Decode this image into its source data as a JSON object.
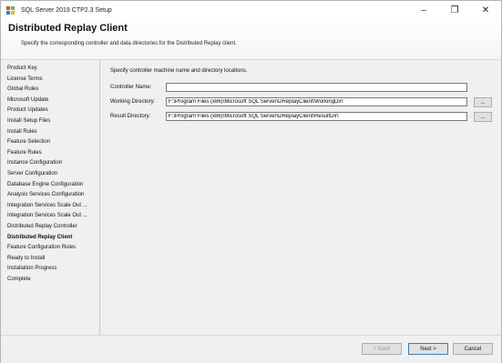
{
  "window": {
    "title": "SQL Server 2019 CTP2.3 Setup",
    "controls": {
      "minimize": "–",
      "maximize": "❐",
      "close": "✕"
    }
  },
  "header": {
    "title": "Distributed Replay Client",
    "subtitle": "Specify the corresponding controller and data directories for the Distributed Replay client."
  },
  "sidebar": {
    "active_index": 21,
    "items": [
      {
        "label": "Product Key"
      },
      {
        "label": "License Terms"
      },
      {
        "label": "Global Rules"
      },
      {
        "label": "Microsoft Update"
      },
      {
        "label": "Product Updates"
      },
      {
        "label": "Install Setup Files"
      },
      {
        "label": "Install Rules"
      },
      {
        "label": "Feature Selection"
      },
      {
        "label": "Feature Rules"
      },
      {
        "label": "Instance Configuration"
      },
      {
        "label": "Server Configuration"
      },
      {
        "label": "Database Engine Configuration"
      },
      {
        "label": "Analysis Services Configuration"
      },
      {
        "label": "Integration Services Scale Out ..."
      },
      {
        "label": "Integration Services Scale Out ..."
      },
      {
        "label": "Distributed Replay Controller"
      },
      {
        "label": "Distributed Replay Client"
      },
      {
        "label": "Feature Configuration Rules"
      },
      {
        "label": "Ready to Install"
      },
      {
        "label": "Installation Progress"
      },
      {
        "label": "Complete"
      }
    ]
  },
  "main": {
    "instruction": "Specify controller machine name and directory locations.",
    "fields": {
      "controller_name": {
        "label": "Controller Name:",
        "value": ""
      },
      "working_directory": {
        "label": "Working Directory:",
        "value": "F:\\Program Files (x86)\\Microsoft SQL Server\\DReplayClient\\WorkingDir\\",
        "browse": "..."
      },
      "result_directory": {
        "label": "Result Directory:",
        "value": "F:\\Program Files (x86)\\Microsoft SQL Server\\DReplayClient\\ResultDir\\",
        "browse": "..."
      }
    }
  },
  "footer": {
    "back": "< Back",
    "next": "Next >",
    "cancel": "Cancel"
  },
  "colors": {
    "primary_border": "#3c7fb1",
    "icon_red": "#e04a2f",
    "icon_yellow": "#f2b705",
    "icon_green": "#7cb342",
    "icon_blue": "#1e88e5"
  }
}
